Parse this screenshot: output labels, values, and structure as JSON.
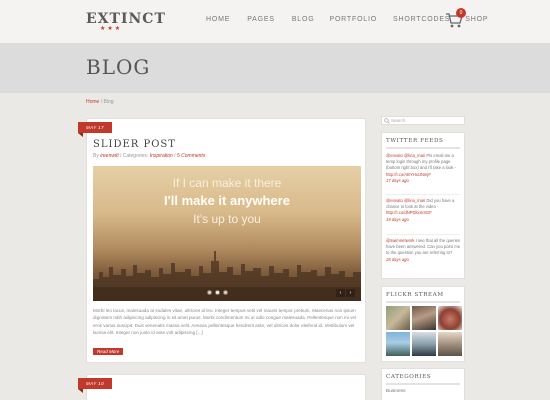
{
  "brand": {
    "name": "EXTINCT",
    "stars": "★★★",
    "accent": "#c0392b"
  },
  "nav": {
    "items": [
      "HOME",
      "PAGES",
      "BLOG",
      "PORTFOLIO",
      "SHORTCODES",
      "SHOP"
    ],
    "cart_icon": "cart-icon",
    "cart_count": "0"
  },
  "page": {
    "title": "BLOG"
  },
  "breadcrumb": {
    "home": "Home",
    "separator": " / ",
    "current": "Blog"
  },
  "posts": [
    {
      "date": "MAY 17",
      "title": "SLIDER POST",
      "meta": {
        "by": "By ",
        "author": "ireenwiti",
        "sep1": " / ",
        "cat_prefix": "Categories: ",
        "category": "Inspiration",
        "sep2": " / ",
        "comments": "5 Comments"
      },
      "slider": {
        "line1": "If I can make it there",
        "line2": "I'll make it anywhere",
        "line3": "It's up to you",
        "slides": 3,
        "active": 2,
        "prev": "‹",
        "next": "›"
      },
      "excerpt": "Morbi leo lacus, malesuada at sodales vitae, ultricies id leo. Integer tempus velit vel mauris tempor pretium. Maecenas non ipsum dignissim nibh adipiscing adipiscing in sit amet purus. Morbi condimentum mi ut odio congue malesuada. Pellentesque non mi vel eros varius suscipit. Duis venenatis massa velit. Aenean pellentesque hendrerit ante, vel ultrices dolor eleifend id. Vestibulum vel lacinia elit. Integer non justo id ante volt adipiscing [...]",
      "read_more": "Read More"
    },
    {
      "date": "MAY 10"
    }
  ],
  "sidebar": {
    "search_placeholder": "Search",
    "twitter": {
      "title": "TWITTER FEEDS",
      "tweets": [
        {
          "user": "@envato",
          "handle": "@lina_mari",
          "text": " Pls email me a temp login through my profile page (bottom right box) and I'll take a look - ",
          "link": "http://t.co/ABYHxUNmjF",
          "time": "17 days ago"
        },
        {
          "user": "@envato",
          "handle": "@lina_mari",
          "text": " Did you have a chance to look at the video - ",
          "link": "http://t.co/dNPDkxmSGF",
          "time": "19 days ago"
        },
        {
          "user": "@swimnetwork",
          "handle": "",
          "text": " I see that all the queries have been answered. Can you point me to the question you are referring to?",
          "link": "",
          "time": "28 days ago"
        }
      ]
    },
    "flickr": {
      "title": "FLICKR STREAM"
    },
    "categories": {
      "title": "CATEGORIES",
      "items": [
        "Business"
      ]
    }
  }
}
